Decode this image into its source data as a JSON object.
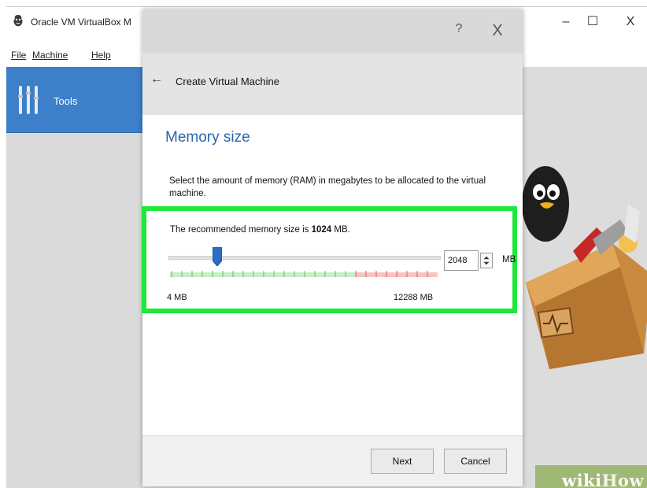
{
  "window": {
    "title": "Oracle VM VirtualBox M",
    "controls": {
      "minimize": "–",
      "maximize": "☐",
      "close": "X"
    }
  },
  "menubar": {
    "items": [
      "File",
      "Machine",
      "Help"
    ]
  },
  "sidebar": {
    "tools_label": "Tools"
  },
  "dialog": {
    "help_label": "?",
    "close_label": "X",
    "back_arrow": "←",
    "title": "Create Virtual Machine",
    "section_title": "Memory size",
    "description": "Select the amount of memory (RAM) in megabytes to be allocated to the virtual machine.",
    "recommend_prefix": "The recommended memory size is ",
    "recommend_value": "1024",
    "recommend_suffix": " MB.",
    "memory": {
      "value": "2048",
      "unit": "MB",
      "min_label": "4 MB",
      "max_label": "12288 MB",
      "slider_fraction": 0.1667
    },
    "buttons": {
      "next": "Next",
      "cancel": "Cancel"
    }
  },
  "watermark": {
    "wiki": "wiki",
    "how": "How"
  },
  "colors": {
    "accent": "#2b65b0",
    "sidebar_selected": "#3d7fc9",
    "highlight": "#1ee83a",
    "slider_handle": "#2b6cc4",
    "tick_green": "#5bc565",
    "tick_red": "#e05a5a",
    "watermark_bg": "#9fb876"
  },
  "icons": {
    "app": "virtualbox-app-icon",
    "tools": "tools-icon",
    "back": "back-arrow-icon",
    "spin": "spin-arrows-icon"
  }
}
